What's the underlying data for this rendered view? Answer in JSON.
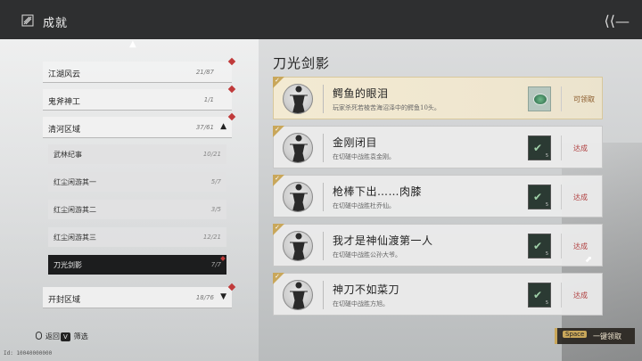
{
  "header": {
    "title": "成就"
  },
  "sidebar": {
    "categories": [
      {
        "name": "江湖风云",
        "count": "21/87",
        "arrow": ""
      },
      {
        "name": "鬼斧神工",
        "count": "1/1",
        "arrow": ""
      },
      {
        "name": "清河区域",
        "count": "37/61",
        "arrow": "▲"
      }
    ],
    "subitems": [
      {
        "name": "武林纪事",
        "count": "10/21"
      },
      {
        "name": "红尘闲游其一",
        "count": "5/7"
      },
      {
        "name": "红尘闲游其二",
        "count": "3/5"
      },
      {
        "name": "红尘闲游其三",
        "count": "12/21"
      },
      {
        "name": "刀光剑影",
        "count": "7/7"
      }
    ],
    "bottom_category": {
      "name": "开封区域",
      "count": "18/76",
      "arrow": "▼"
    }
  },
  "main": {
    "section_title": "刀光剑影",
    "achievements": [
      {
        "title": "鳄鱼的眼泪",
        "desc": "玩家杀死若棱苦海沼泽中的鳄鱼10头。",
        "status": "可领取",
        "reward": "jade-icon"
      },
      {
        "title": "金刚闭目",
        "desc": "在切磋中战胜袁金刚。",
        "status": "达成",
        "reward_count": "5"
      },
      {
        "title": "枪棒下出……肉膝",
        "desc": "在切磋中战胜杜乔仙。",
        "status": "达成",
        "reward_count": "5"
      },
      {
        "title": "我才是神仙渡第一人",
        "desc": "在切磋中战胜公孙大爷。",
        "status": "达成",
        "reward_count": "5"
      },
      {
        "title": "神刀不如菜刀",
        "desc": "在切磋中战胜方旭。",
        "status": "达成",
        "reward_count": "5"
      }
    ]
  },
  "footer": {
    "back_label": "返回",
    "filter_key": "V",
    "filter_label": "筛选",
    "claim_all_key": "Space",
    "claim_all_label": "一键领取",
    "uid": "Id: 10040000000"
  },
  "colors": {
    "accent_gold": "#c9a75a",
    "status_red": "#b04040",
    "selected_dark": "#1c1d1e"
  }
}
